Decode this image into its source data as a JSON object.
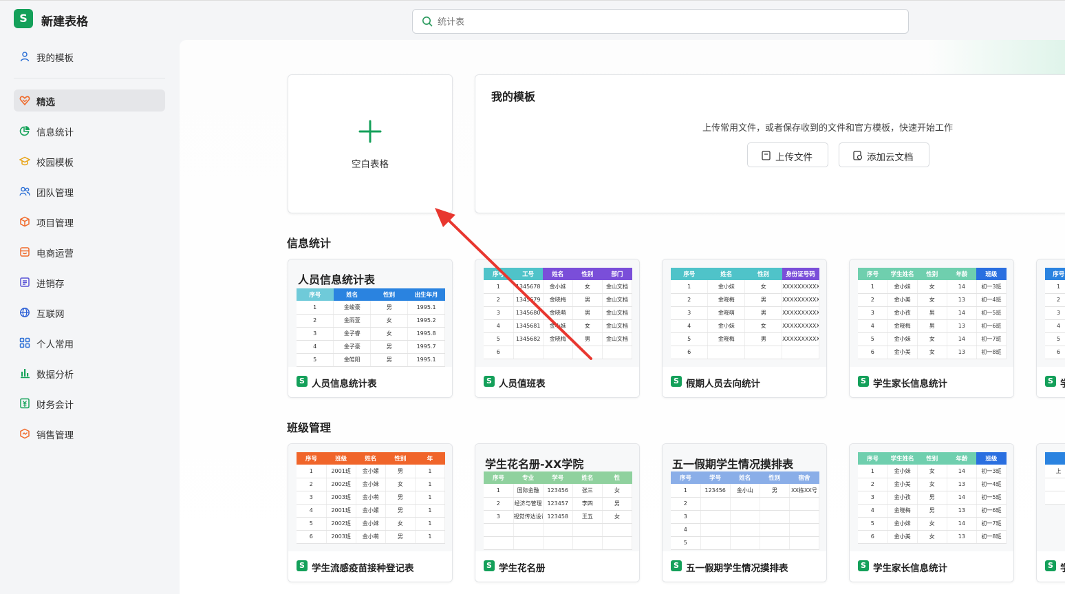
{
  "app": {
    "title": "新建表格",
    "logo_letter": "S"
  },
  "search": {
    "placeholder": "统计表"
  },
  "sidebar": {
    "items": [
      {
        "label": "我的模板",
        "icon": "user-icon"
      },
      {
        "label": "精选",
        "icon": "heart-badge-icon"
      },
      {
        "label": "信息统计",
        "icon": "pie-chart-icon"
      },
      {
        "label": "校园模板",
        "icon": "graduation-cap-icon"
      },
      {
        "label": "团队管理",
        "icon": "team-icon"
      },
      {
        "label": "项目管理",
        "icon": "box-icon"
      },
      {
        "label": "电商运营",
        "icon": "shop-icon"
      },
      {
        "label": "进销存",
        "icon": "inventory-icon"
      },
      {
        "label": "互联网",
        "icon": "globe-icon"
      },
      {
        "label": "个人常用",
        "icon": "apps-icon"
      },
      {
        "label": "数据分析",
        "icon": "bar-chart-icon"
      },
      {
        "label": "财务会计",
        "icon": "finance-icon"
      },
      {
        "label": "销售管理",
        "icon": "sales-icon"
      }
    ]
  },
  "blank": {
    "label": "空白表格"
  },
  "my_templates": {
    "title": "我的模板",
    "description": "上传常用文件，或者保存收到的文件和官方模板，快速开始工作",
    "upload_label": "上传文件",
    "add_cloud_label": "添加云文档"
  },
  "sections": {
    "info": {
      "title": "信息统计",
      "cards": [
        {
          "name": "人员信息统计表",
          "sheet_title": "人员信息统计表",
          "headers": [
            "序号",
            "姓名",
            "性别",
            "出生年月"
          ],
          "rows": [
            [
              "1",
              "金峻豪",
              "男",
              "1995.1"
            ],
            [
              "2",
              "金雨萱",
              "女",
              "1995.2"
            ],
            [
              "3",
              "金子睿",
              "女",
              "1995.8"
            ],
            [
              "4",
              "金子豪",
              "男",
              "1995.7"
            ],
            [
              "5",
              "金皓阳",
              "男",
              "1995.1"
            ]
          ]
        },
        {
          "name": "人员值班表",
          "headers": [
            "序号",
            "工号",
            "姓名",
            "性别",
            "部门"
          ],
          "rows": [
            [
              "1",
              "1345678",
              "金小妹",
              "女",
              "金山文档"
            ],
            [
              "2",
              "1345679",
              "金晓梅",
              "男",
              "金山文档"
            ],
            [
              "3",
              "1345680",
              "金晓萌",
              "男",
              "金山文档"
            ],
            [
              "4",
              "1345681",
              "金小妹",
              "女",
              "金山文档"
            ],
            [
              "5",
              "1345682",
              "金晓梅",
              "男",
              "金山文档"
            ],
            [
              "6",
              "",
              "",
              "",
              ""
            ]
          ]
        },
        {
          "name": "假期人员去向统计",
          "headers": [
            "序号",
            "姓名",
            "性别",
            "身份证号码"
          ],
          "rows": [
            [
              "1",
              "金小妹",
              "女",
              "XXXXXXXXXXXXX"
            ],
            [
              "2",
              "金晓梅",
              "男",
              "XXXXXXXXXXXXX"
            ],
            [
              "3",
              "金晓萌",
              "男",
              "XXXXXXXXXXXXX"
            ],
            [
              "4",
              "金小妹",
              "女",
              "XXXXXXXXXXXXX"
            ],
            [
              "5",
              "金晓梅",
              "男",
              "XXXXXXXXXXXXX"
            ],
            [
              "6",
              "",
              "",
              ""
            ]
          ]
        },
        {
          "name": "学生家长信息统计",
          "headers": [
            "序号",
            "学生姓名",
            "性别",
            "年龄",
            "班级"
          ],
          "rows": [
            [
              "1",
              "金小妹",
              "女",
              "14",
              "初一3班"
            ],
            [
              "2",
              "金小美",
              "女",
              "13",
              "初一4班"
            ],
            [
              "3",
              "金小孜",
              "男",
              "14",
              "初一5班"
            ],
            [
              "4",
              "金晓梅",
              "男",
              "13",
              "初一6班"
            ],
            [
              "5",
              "金小妹",
              "女",
              "14",
              "初一7班"
            ],
            [
              "6",
              "金小美",
              "女",
              "13",
              "初一8班"
            ]
          ]
        },
        {
          "name": "学",
          "headers": [
            "序号"
          ],
          "rows": [
            [
              "1"
            ],
            [
              "2"
            ],
            [
              "3"
            ],
            [
              "4"
            ],
            [
              "5"
            ],
            [
              "6"
            ]
          ]
        }
      ]
    },
    "class": {
      "title": "班级管理",
      "cards": [
        {
          "name": "学生流感疫苗接种登记表",
          "headers": [
            "序号",
            "班级",
            "姓名",
            "性别",
            "年"
          ],
          "rows": [
            [
              "1",
              "2001班",
              "金小嫘",
              "男",
              "1"
            ],
            [
              "2",
              "2002班",
              "金小妹",
              "女",
              "1"
            ],
            [
              "3",
              "2003班",
              "金小萌",
              "男",
              "1"
            ],
            [
              "4",
              "2001班",
              "金小嫘",
              "男",
              "1"
            ],
            [
              "5",
              "2002班",
              "金小妹",
              "女",
              "1"
            ],
            [
              "6",
              "2003班",
              "金小萌",
              "男",
              "1"
            ]
          ]
        },
        {
          "name": "学生花名册",
          "sheet_title": "学生花名册-XX学院",
          "headers": [
            "序号",
            "专业",
            "学号",
            "姓名",
            "性"
          ],
          "rows": [
            [
              "1",
              "国际金融",
              "123456",
              "张三",
              "女"
            ],
            [
              "2",
              "经济与管理",
              "123457",
              "李四",
              "男"
            ],
            [
              "3",
              "视觉传达设计",
              "123458",
              "王五",
              "女"
            ],
            [
              "",
              "",
              "",
              "",
              ""
            ],
            [
              "",
              "",
              "",
              "",
              ""
            ]
          ]
        },
        {
          "name": "五一假期学生情况摸排表",
          "sheet_title": "五一假期学生情况摸排表",
          "headers": [
            "序号",
            "学号",
            "姓名",
            "性别",
            "宿舍"
          ],
          "rows": [
            [
              "1",
              "123456",
              "金小山",
              "男",
              "XX栋XX号"
            ],
            [
              "2",
              "",
              "",
              "",
              ""
            ],
            [
              "3",
              "",
              "",
              "",
              ""
            ],
            [
              "4",
              "",
              "",
              "",
              ""
            ],
            [
              "5",
              "",
              "",
              "",
              ""
            ]
          ]
        },
        {
          "name": "学生家长信息统计",
          "headers": [
            "序号",
            "学生姓名",
            "性别",
            "年龄",
            "班级"
          ],
          "rows": [
            [
              "1",
              "金小妹",
              "女",
              "14",
              "初一3班"
            ],
            [
              "2",
              "金小美",
              "女",
              "13",
              "初一4班"
            ],
            [
              "3",
              "金小孜",
              "男",
              "14",
              "初一5班"
            ],
            [
              "4",
              "金晓梅",
              "男",
              "13",
              "初一6班"
            ],
            [
              "5",
              "金小妹",
              "女",
              "14",
              "初一7班"
            ],
            [
              "6",
              "金小美",
              "女",
              "13",
              "初一8班"
            ]
          ]
        },
        {
          "name": "学",
          "headers": [
            ""
          ],
          "rows": [
            [
              "上"
            ],
            [
              ""
            ],
            [
              ""
            ]
          ]
        }
      ]
    }
  },
  "colors": {
    "brand_green": "#14a05a",
    "annotation_arrow": "#e8372f"
  }
}
